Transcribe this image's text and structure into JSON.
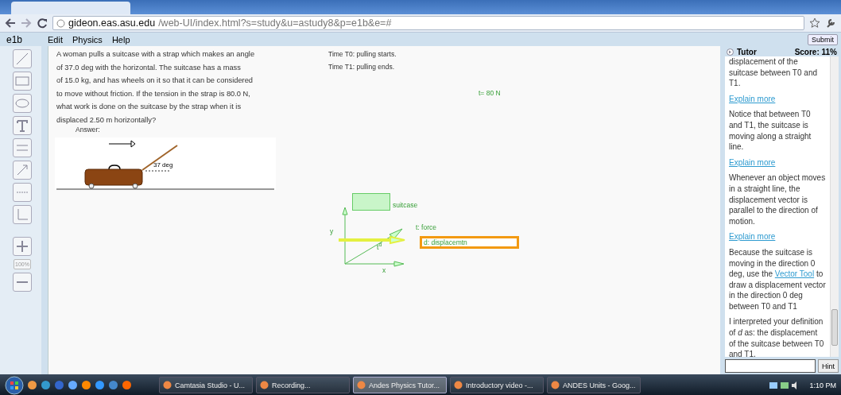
{
  "browser": {
    "url_host": "gideon.eas.asu.edu",
    "url_path": "/web-UI/index.html?s=study&u=astudy8&p=e1b&e=#"
  },
  "menu_bar": {
    "title": "e1b",
    "items": [
      "Edit",
      "Physics",
      "Help"
    ],
    "submit": "Submit"
  },
  "tools": [
    {
      "kind": "line"
    },
    {
      "kind": "rectangle"
    },
    {
      "kind": "ellipse"
    },
    {
      "kind": "text"
    },
    {
      "kind": "equation"
    },
    {
      "kind": "vector"
    },
    {
      "kind": "zaxis"
    },
    {
      "kind": "axes"
    },
    {
      "kind": "zoom_in"
    },
    {
      "kind": "zoom_label",
      "label": "100%"
    },
    {
      "kind": "zoom_out"
    }
  ],
  "problem": {
    "lines": [
      "A woman pulls a suitcase with a strap which makes an angle",
      "of 37.0 deg with the horizontal. The suitcase has a mass",
      "of 15.0 kg, and has wheels on it so that it can be considered",
      "to move without friction. If the tension in the strap is 80.0 N,",
      "what work is done on the suitcase by the strap when it is",
      "displaced 2.50 m horizontally?"
    ],
    "answer_label": "Answer:",
    "figure": {
      "angle_label": "37 deg"
    }
  },
  "canvas": {
    "notes": [
      "Time T0: pulling starts.",
      "Time T1: pulling ends."
    ],
    "tension": "t= 80 N",
    "body_label": "suitcase",
    "axis_y": "y",
    "axis_x": "x",
    "force_label": "t: force",
    "angle_mark": "t$^{d}$",
    "displacement": {
      "label": "d: displacemtn",
      "selected": true
    }
  },
  "tutor": {
    "title": "Tutor",
    "score": "Score: 11%",
    "messages": [
      {
        "kind": "text",
        "text": "displacement of the suitcase between T0 and T1."
      },
      {
        "kind": "link",
        "text": "Explain more"
      },
      {
        "kind": "text",
        "text": "Notice that between T0 and T1, the suitcase is moving along a straight line."
      },
      {
        "kind": "link",
        "text": "Explain more"
      },
      {
        "kind": "text",
        "text": "Whenever an object moves in a straight line, the displacement vector is parallel to the direction of motion."
      },
      {
        "kind": "link",
        "text": "Explain more"
      },
      {
        "kind": "mixed",
        "before": "Because the suitcase is moving in the direction 0 deg, use the ",
        "link": "Vector Tool",
        "after": " to draw a displacement vector in the direction 0 deg between T0 and T1"
      },
      {
        "kind": "text",
        "text": "I interpreted your definition of *d* as:  the displacement of the suitcase between T0 and T1."
      }
    ],
    "hint_button": "Hint"
  },
  "taskbar": {
    "tasks": [
      {
        "label": "Camtasia Studio - U...",
        "selected": false
      },
      {
        "label": "Recording...",
        "selected": false
      },
      {
        "label": "Andes Physics Tutor...",
        "selected": true
      },
      {
        "label": "Introductory video -...",
        "selected": false
      },
      {
        "label": "ANDES Units - Goog...",
        "selected": false
      }
    ],
    "clock": "1:10 PM"
  }
}
